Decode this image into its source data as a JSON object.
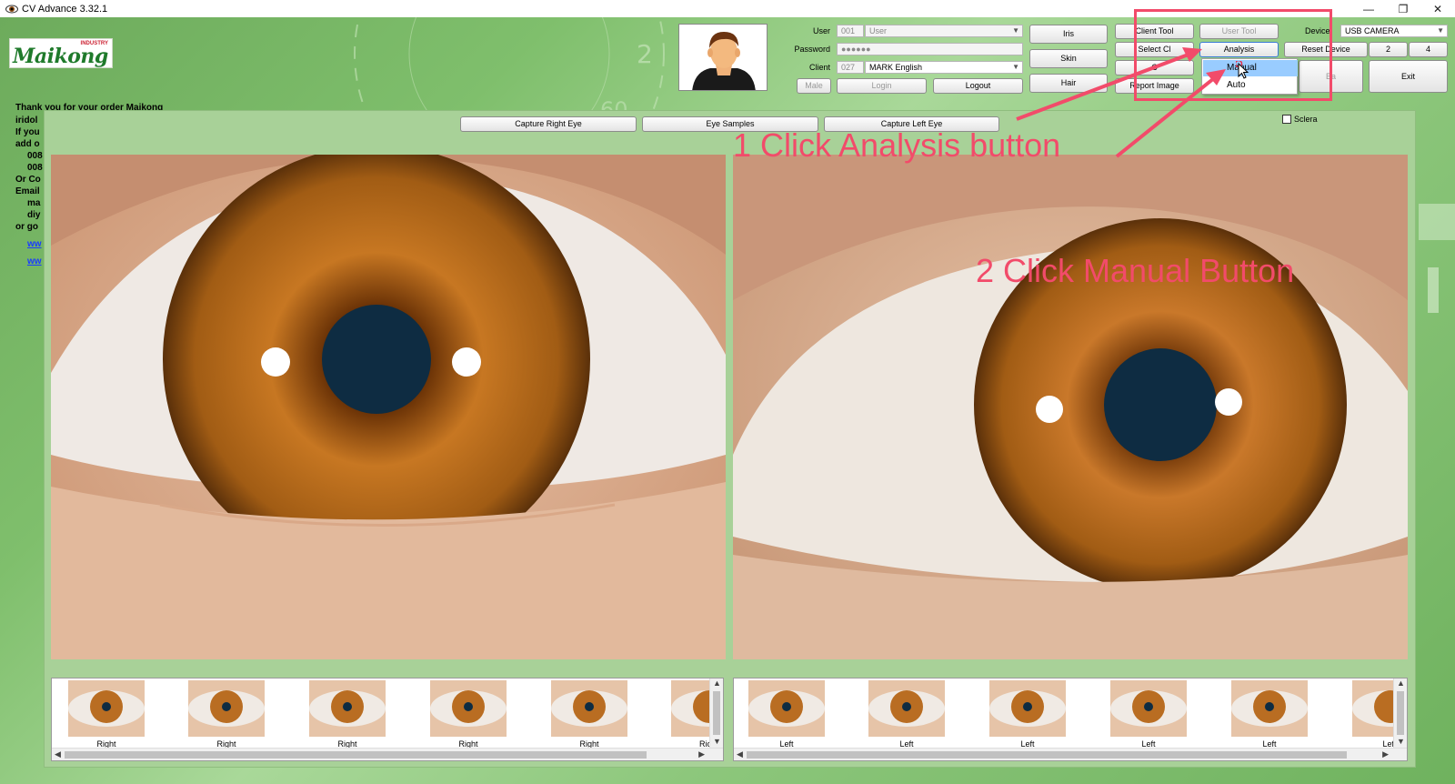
{
  "window": {
    "title": "CV Advance 3.32.1",
    "minimize": "—",
    "maximize": "❐",
    "close": "✕"
  },
  "logo": {
    "text": "Maikong",
    "subtitle": "INDUSTRY"
  },
  "notice": {
    "lines": [
      "Thank you for your order Maikong",
      "iridol",
      "If you",
      "add o",
      "008",
      "008",
      "Or Co",
      "Email",
      "ma",
      "diy",
      "or go"
    ],
    "links": [
      "ww",
      "ww"
    ]
  },
  "user_form": {
    "user_label": "User",
    "user_id": "001",
    "user_name": "User",
    "password_label": "Password",
    "password_value": "●●●●●●",
    "client_label": "Client",
    "client_id": "027",
    "client_name": "MARK English",
    "gender": "Male",
    "login": "Login",
    "logout": "Logout"
  },
  "buttons": {
    "iris": "Iris",
    "skin": "Skin",
    "hair": "Hair",
    "client_tool": "Client Tool",
    "user_tool": "User Tool",
    "select_client": "Select Cl",
    "analysis": "Analysis",
    "report_image": "Report Image",
    "back": "Ba",
    "exit": "Exit",
    "reset_device": "Reset Device",
    "num_2": "2",
    "num_4": "4",
    "hidden_c": "C"
  },
  "device": {
    "label": "Device:",
    "value": "USB CAMERA"
  },
  "analysis_menu": {
    "items": [
      "Manual",
      "Auto"
    ],
    "highlighted": "Manual"
  },
  "capture": {
    "right": "Capture Right Eye",
    "samples": "Eye Samples",
    "left": "Capture Left Eye",
    "sclera": "Sclera"
  },
  "thumbs": {
    "right": [
      "Right",
      "Right",
      "Right",
      "Right",
      "Right",
      "Ric"
    ],
    "left": [
      "Left",
      "Left",
      "Left",
      "Left",
      "Left",
      "Lef"
    ]
  },
  "annotations": {
    "step1": "1 Click Analysis button",
    "step2": "2 Click Manual Button",
    "color": "#f24b6a"
  },
  "colors": {
    "iris": "#b0671f",
    "pupil": "#0e2c42",
    "panel": "#a8d198"
  }
}
